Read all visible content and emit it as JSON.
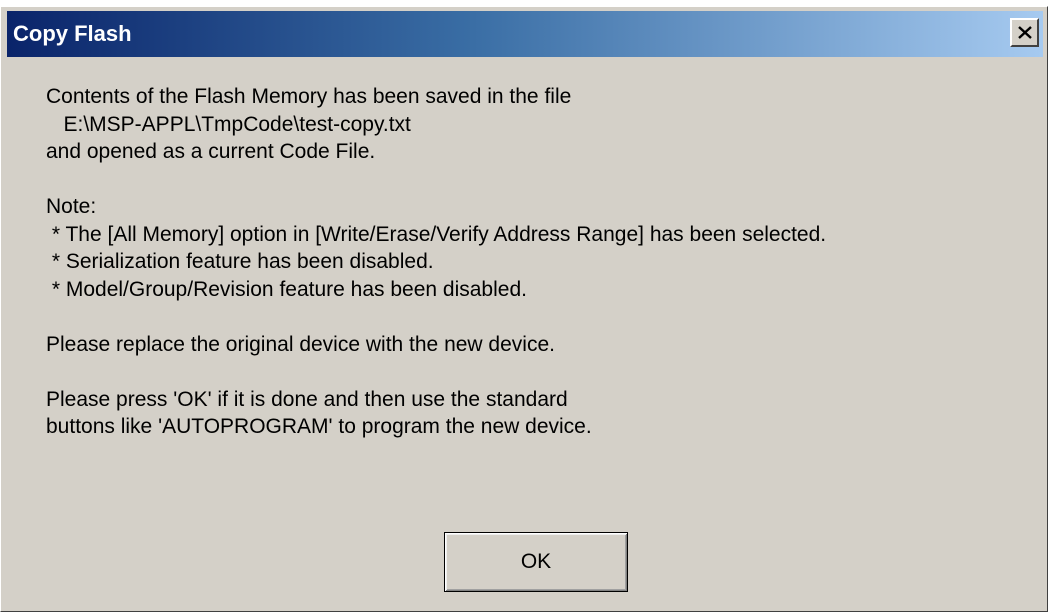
{
  "window": {
    "title": "Copy Flash",
    "close_icon": "close-icon"
  },
  "message": {
    "lines": [
      "Contents of the Flash Memory has been saved in the file",
      "   E:\\MSP-APPL\\TmpCode\\test-copy.txt",
      "and opened as a current Code File.",
      "",
      "Note:",
      " * The [All Memory] option in [Write/Erase/Verify Address Range] has been selected.",
      " * Serialization feature has been disabled.",
      " * Model/Group/Revision feature has been disabled.",
      "",
      "Please replace the original device with the new device.",
      "",
      "Please press 'OK' if it is done and then use the standard",
      "buttons like 'AUTOPROGRAM' to program the new device."
    ]
  },
  "buttons": {
    "ok_label": "OK"
  },
  "colors": {
    "dialog_face": "#d4d0c8",
    "titlebar_start": "#0a246a",
    "titlebar_end": "#a6caf0",
    "title_text": "#ffffff"
  }
}
